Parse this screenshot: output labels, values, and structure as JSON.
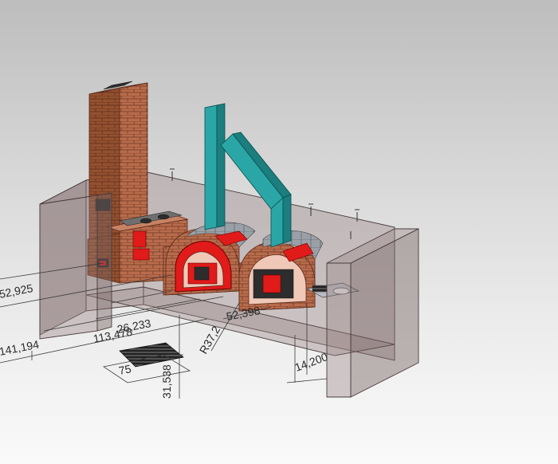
{
  "dimensions": [
    {
      "id": "d1",
      "text": "52,925"
    },
    {
      "id": "d2",
      "text": "26,233"
    },
    {
      "id": "d3",
      "text": "113,478"
    },
    {
      "id": "d4",
      "text": "141,194"
    },
    {
      "id": "d5",
      "text": "75"
    },
    {
      "id": "d6",
      "text": "31,538"
    },
    {
      "id": "d7",
      "text": "R37,2"
    },
    {
      "id": "d8",
      "text": "52,398"
    },
    {
      "id": "d9",
      "text": "14,200"
    }
  ],
  "colors": {
    "brick": "#b46a4a",
    "flue": "#2aa6a6",
    "accent_red": "#e11a1a",
    "wall_glass": "#968282",
    "background_top": "#bdbdbd",
    "background_bottom": "#fafafa"
  }
}
